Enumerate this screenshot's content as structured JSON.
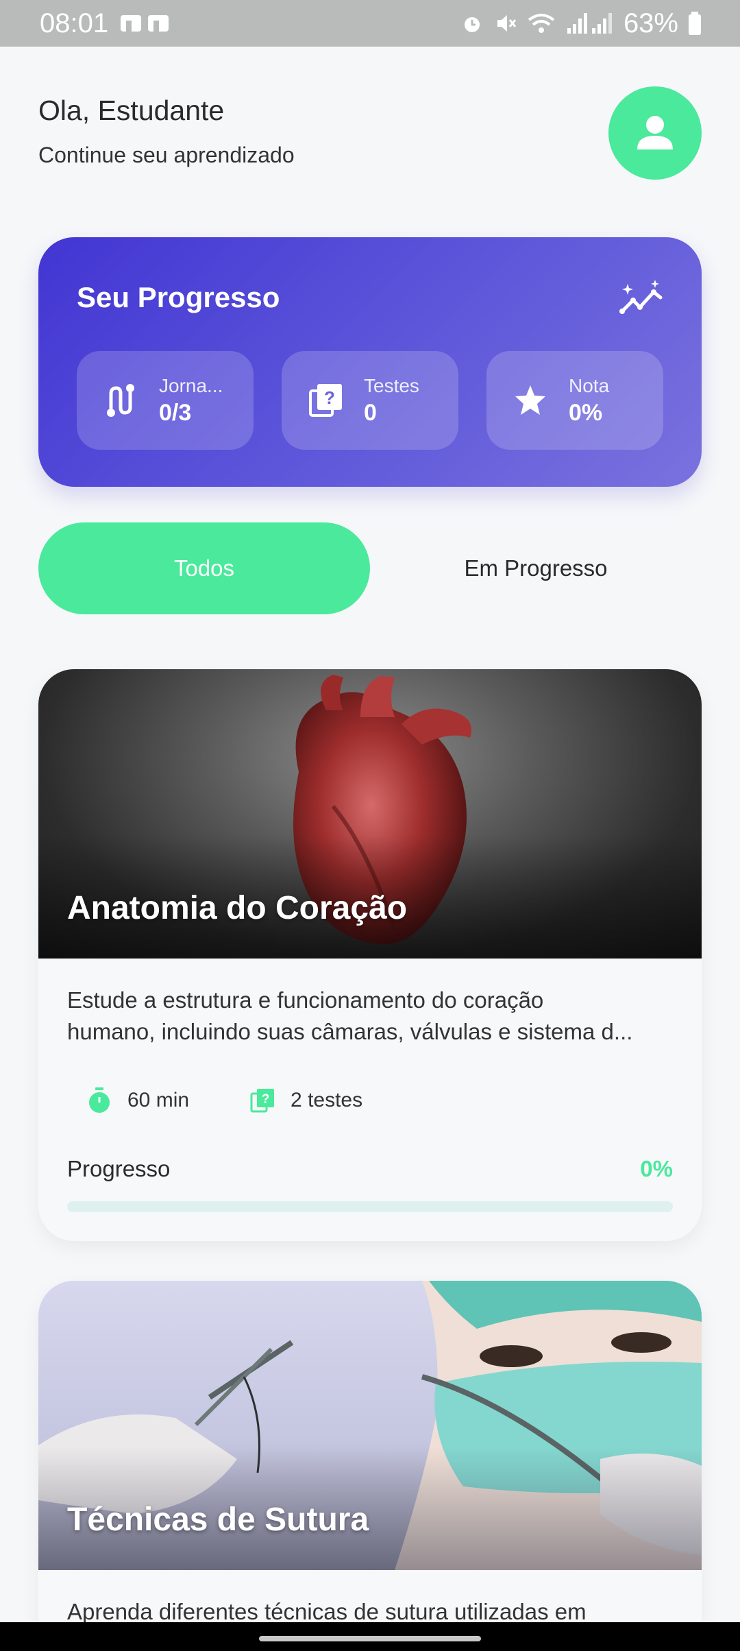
{
  "status_bar": {
    "time": "08:01",
    "battery": "63%"
  },
  "header": {
    "greeting": "Ola, Estudante",
    "subtitle": "Continue seu aprendizado"
  },
  "progress": {
    "title": "Seu Progresso",
    "stats": [
      {
        "label": "Jorna...",
        "value": "0/3",
        "icon": "route-icon"
      },
      {
        "label": "Testes",
        "value": "0",
        "icon": "quiz-icon"
      },
      {
        "label": "Nota",
        "value": "0%",
        "icon": "star-icon"
      }
    ]
  },
  "tabs": [
    {
      "label": "Todos",
      "active": true
    },
    {
      "label": "Em Progresso",
      "active": false
    }
  ],
  "courses": [
    {
      "title": "Anatomia do Coração",
      "description_line1": "Estude a estrutura e funcionamento do coração",
      "description_line2": "humano, incluindo suas câmaras, válvulas e sistema d...",
      "duration": "60 min",
      "tests": "2 testes",
      "progress_label": "Progresso",
      "progress_value": "0%",
      "progress_fraction": 0,
      "image": "heart-image"
    },
    {
      "title": "Técnicas de Sutura",
      "description_line1": "Aprenda diferentes técnicas de sutura utilizadas em",
      "image": "surgeon-image"
    }
  ],
  "colors": {
    "accent": "#4ae99c",
    "card_gradient_start": "#4235d3",
    "card_gradient_end": "#7a72de"
  }
}
